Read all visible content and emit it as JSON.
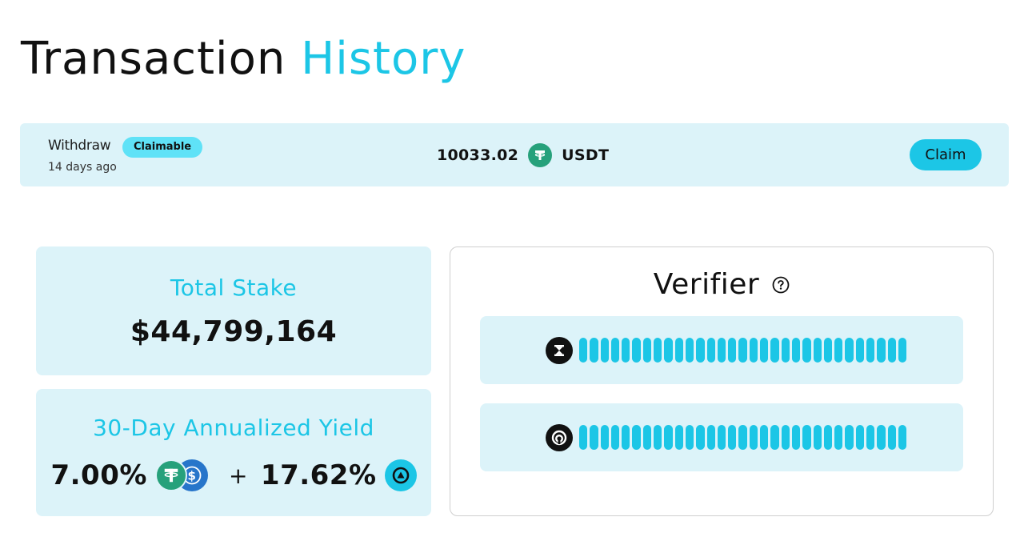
{
  "header": {
    "title_part1": "Transaction",
    "title_part2": "History"
  },
  "transaction": {
    "type": "Withdraw",
    "status_badge": "Claimable",
    "time": "14 days ago",
    "amount": "10033.02",
    "token_icon": "tether-icon",
    "token": "USDT",
    "action_label": "Claim"
  },
  "total_stake": {
    "label": "Total Stake",
    "value": "$44,799,164"
  },
  "yield": {
    "label": "30-Day Annualized Yield",
    "base_rate": "7.00%",
    "base_icons": [
      "tether-icon",
      "usdc-icon"
    ],
    "plus": "+",
    "bonus_rate": "17.62%",
    "bonus_icon": "protocol-token-icon"
  },
  "verifier": {
    "title": "Verifier",
    "help_icon": "help-circle-icon",
    "rows": [
      {
        "icon": "hourglass-logo-icon",
        "masked": true
      },
      {
        "icon": "ring-logo-icon",
        "masked": true
      }
    ]
  },
  "colors": {
    "accent": "#1cc6e6",
    "card_bg": "#dcf3f9",
    "badge_bg": "#5fe2f7",
    "tether_green": "#26a17b",
    "usdc_blue": "#2775ca",
    "text": "#111111"
  }
}
